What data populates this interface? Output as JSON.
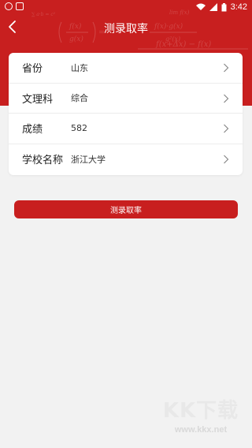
{
  "status_bar": {
    "time": "3:42"
  },
  "header": {
    "title": "测录取率",
    "background_color": "#c81f1f"
  },
  "form": {
    "rows": [
      {
        "label": "省份",
        "value": "山东"
      },
      {
        "label": "文理科",
        "value": "综合"
      },
      {
        "label": "成绩",
        "value": "582"
      },
      {
        "label": "学校名称",
        "value": "浙江大学"
      }
    ]
  },
  "submit": {
    "label": "测录取率"
  },
  "watermark": {
    "logo": "KK下载",
    "url": "www.kkx.net"
  }
}
